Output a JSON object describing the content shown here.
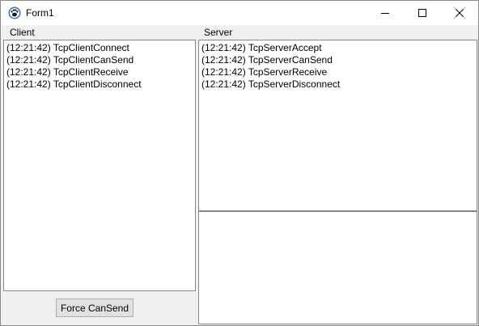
{
  "window": {
    "title": "Form1",
    "icon": "app-icon",
    "caption_buttons": {
      "minimize": "minimize-icon",
      "maximize": "maximize-icon",
      "close": "close-icon"
    }
  },
  "client": {
    "label": "Client",
    "log": [
      "(12:21:42) TcpClientConnect",
      "(12:21:42) TcpClientCanSend",
      "(12:21:42) TcpClientReceive",
      "(12:21:42) TcpClientDisconnect"
    ],
    "force_button": "Force CanSend"
  },
  "server": {
    "label": "Server",
    "log": [
      "(12:21:42) TcpServerAccept",
      "(12:21:42) TcpServerCanSend",
      "(12:21:42) TcpServerReceive",
      "(12:21:42) TcpServerDisconnect"
    ],
    "secondary_log": []
  }
}
